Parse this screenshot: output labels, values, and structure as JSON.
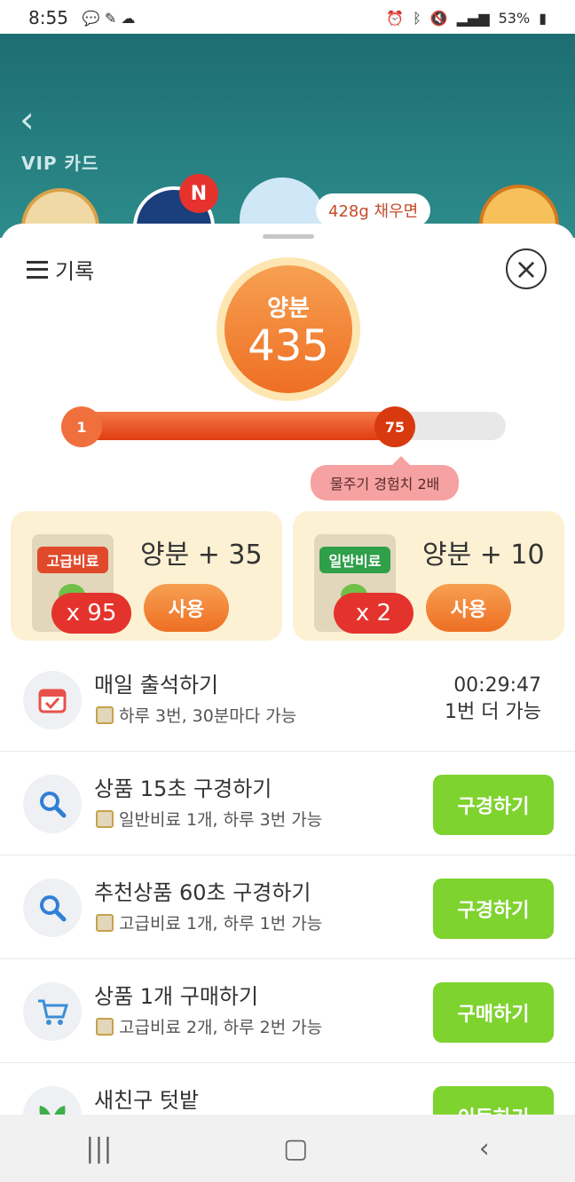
{
  "status": {
    "time": "8:55",
    "battery": "53%"
  },
  "background": {
    "vip_label": "VIP 카드",
    "notice_badge": "N",
    "bubble": "428g 채우면"
  },
  "sheet": {
    "records_label": "기록",
    "nutrient": {
      "label": "양분",
      "value": "435"
    },
    "progress": {
      "start": "1",
      "level": "75",
      "fraction": 0.75
    },
    "tooltip": "물주기 경험치 2배"
  },
  "fertilizers": [
    {
      "tag": "고급비료",
      "count": "x 95",
      "bonus": "양분 + 35",
      "button": "사용",
      "tag_color": "#e04a2b"
    },
    {
      "tag": "일반비료",
      "count": "x 2",
      "bonus": "양분 + 10",
      "button": "사용",
      "tag_color": "#2f9f49"
    }
  ],
  "tasks": [
    {
      "title": "매일 출석하기",
      "sub": "하루 3번, 30분마다 가능",
      "timer": "00:29:47",
      "timer_note": "1번 더 가능",
      "icon": "calendar-icon"
    },
    {
      "title": "상품 15초 구경하기",
      "sub": "일반비료 1개, 하루 3번 가능",
      "button": "구경하기",
      "icon": "search-icon"
    },
    {
      "title": "추천상품 60초 구경하기",
      "sub": "고급비료 1개, 하루 1번 가능",
      "button": "구경하기",
      "icon": "search-icon"
    },
    {
      "title": "상품 1개 구매하기",
      "sub": "고급비료 2개, 하루 2번 가능",
      "button": "구매하기",
      "icon": "cart-icon"
    },
    {
      "title": "새친구 텃밭",
      "sub": "",
      "button": "이동하기",
      "icon": "leaf-icon"
    }
  ],
  "colors": {
    "accent_orange": "#ee6f23",
    "green_button": "#7ed32f",
    "progress_red": "#e13c13"
  }
}
